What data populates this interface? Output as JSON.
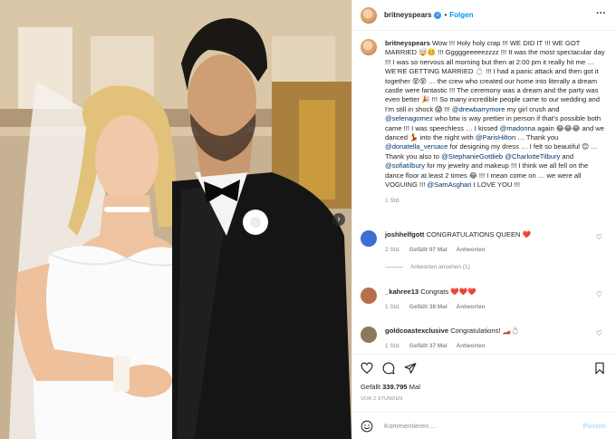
{
  "header": {
    "username": "britneyspears",
    "separator": "•",
    "follow_label": "Folgen",
    "more_label": "···"
  },
  "caption": {
    "username": "britneyspears",
    "segments": [
      {
        "t": "Wow !!! Holy holy crap !!! WE DID IT !!! WE GOT MARRIED 🤯🥴 !!! Gggggeeeeezzzz !!! It was the most spectacular day !!! I was so nervous all morning but then at 2:00 pm it really hit me … WE’RE GETTING MARRIED 💍 !!! I had a panic attack and then got it together 😵😵 … the crew who created our home into literally a dream castle were fantastic !!! The ceremony was a dream and the party was even better 🎉 !!! So many incredible people came to our wedding and I’m still in shock 😱 !!! "
      },
      {
        "m": "@drewbarrymore"
      },
      {
        "t": " my girl crush and "
      },
      {
        "m": "@selenagomez"
      },
      {
        "t": " who btw is way prettier in person if that’s possible both came !!! I was speechless … I kissed "
      },
      {
        "m": "@madonna"
      },
      {
        "t": " again 😂😂😂 and we danced 💃 into the night with "
      },
      {
        "m": "@ParisHilton"
      },
      {
        "t": " … Thank you "
      },
      {
        "m": "@donatella_versace"
      },
      {
        "t": " for designing my dress … I felt so beautiful 😊 … Thank you also to "
      },
      {
        "m": "@StephanieGottlieb"
      },
      {
        "t": " "
      },
      {
        "m": "@CharlotteTilbury"
      },
      {
        "t": " and "
      },
      {
        "m": "@sofiatilbury"
      },
      {
        "t": " for my jewelry and makeup !!! I think we all fell on the dance floor at least 2 times 😂 !!! I mean come on … we were all VOGUING !!! "
      },
      {
        "m": "@SamAsghari"
      },
      {
        "t": " I LOVE YOU !!!"
      }
    ],
    "time": "1 Std."
  },
  "comments": [
    {
      "username": "joshhelfgott",
      "text": "CONGRATULATIONS QUEEN ❤️",
      "time": "2 Std.",
      "likes": "Gefällt 97 Mal",
      "reply": "Antworten",
      "view_replies": "Antworten ansehen (1)",
      "avatar_color": "#3b6fd1"
    },
    {
      "username": "_kahree13",
      "text": "Congrats ❤️❤️❤️",
      "time": "1 Std.",
      "likes": "Gefällt 38 Mal",
      "reply": "Antworten",
      "avatar_color": "#b5704a"
    },
    {
      "username": "goldcoastexclusive",
      "text": "Congratulations! 🏎️💍",
      "time": "1 Std.",
      "likes": "Gefällt 37 Mal",
      "reply": "Antworten",
      "avatar_color": "#8a7a5a"
    }
  ],
  "actions": {
    "likes_prefix": "Gefällt",
    "likes_count": "339.795",
    "likes_suffix": "Mal",
    "date": "VOR 2 STUNDEN"
  },
  "add_comment": {
    "placeholder": "Kommentieren ...",
    "post_label": "Posten"
  },
  "media": {
    "next_label": "›"
  },
  "colors": {
    "link": "#0095f6",
    "mention": "#00376b",
    "verified": "#3897f0",
    "muted": "#8e8e8e"
  }
}
